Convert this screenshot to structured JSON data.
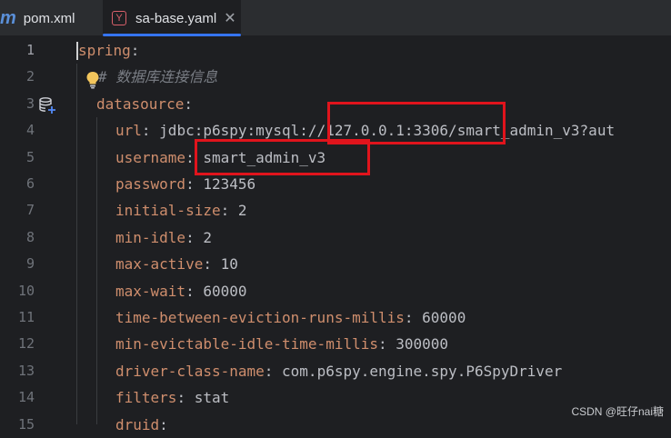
{
  "tabs": [
    {
      "label": "pom.xml",
      "icon": "maven-icon",
      "active": false
    },
    {
      "label": "sa-base.yaml",
      "icon": "yaml-file-icon",
      "active": true
    }
  ],
  "tab_icon_text": {
    "maven": "m",
    "yaml": "Y"
  },
  "line_numbers": [
    "1",
    "2",
    "3",
    "4",
    "5",
    "6",
    "7",
    "8",
    "9",
    "10",
    "11",
    "12",
    "13",
    "14",
    "15"
  ],
  "code": {
    "l1_key": "spring",
    "l1_colon": ":",
    "l2_comment": "# 数据库连接信息",
    "l3_key": "datasource",
    "l3_colon": ":",
    "l4_key": "url",
    "l4_sep": ": ",
    "l4_val": "jdbc:p6spy:mysql://127.0.0.1:3306/smart_admin_v3?aut",
    "l5_key": "username",
    "l5_sep": ": ",
    "l5_val": "smart_admin_v3",
    "l6_key": "password",
    "l6_sep": ": ",
    "l6_val": "123456",
    "l7_key": "initial-size",
    "l7_sep": ": ",
    "l7_val": "2",
    "l8_key": "min-idle",
    "l8_sep": ": ",
    "l8_val": "2",
    "l9_key": "max-active",
    "l9_sep": ": ",
    "l9_val": "10",
    "l10_key": "max-wait",
    "l10_sep": ": ",
    "l10_val": "60000",
    "l11_key": "time-between-eviction-runs-millis",
    "l11_sep": ": ",
    "l11_val": "60000",
    "l12_key": "min-evictable-idle-time-millis",
    "l12_sep": ": ",
    "l12_val": "300000",
    "l13_key": "driver-class-name",
    "l13_sep": ": ",
    "l13_val": "com.p6spy.engine.spy.P6SpyDriver",
    "l14_key": "filters",
    "l14_sep": ": ",
    "l14_val": "stat",
    "l15_key": "druid",
    "l15_colon": ":"
  },
  "watermark": "CSDN @旺仔nai糖",
  "colors": {
    "keyword": "#cf8e6d",
    "comment": "#7a7e85",
    "annotation_box": "#e0141c",
    "active_tab_underline": "#3574f0"
  }
}
